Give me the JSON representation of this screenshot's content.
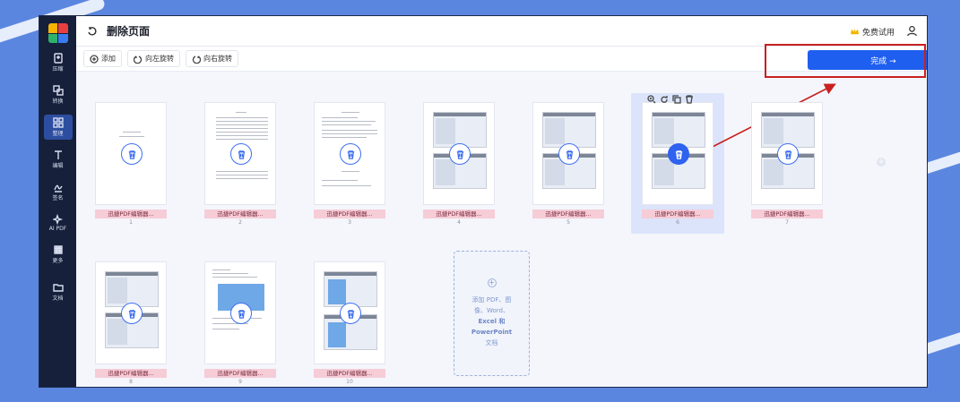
{
  "app": {
    "title": "删除页面",
    "trial_label": "免费试用"
  },
  "sidebar": {
    "items": [
      {
        "label": "压缩",
        "icon": "compress-icon"
      },
      {
        "label": "转换",
        "icon": "convert-icon"
      },
      {
        "label": "整理",
        "icon": "organize-icon",
        "active": true
      },
      {
        "label": "编辑",
        "icon": "text-edit-icon"
      },
      {
        "label": "签名",
        "icon": "signature-icon"
      },
      {
        "label": "AI PDF",
        "icon": "ai-sparkle-icon"
      },
      {
        "label": "更多",
        "icon": "grid-more-icon"
      },
      {
        "label": "文档",
        "icon": "folder-icon"
      }
    ]
  },
  "toolbar": {
    "add_label": "添加",
    "rotate_left_label": "向左旋转",
    "rotate_right_label": "向右旋转"
  },
  "done_button": {
    "label": "完成 →"
  },
  "pages": [
    {
      "label": "迅捷PDF编辑器...",
      "number": "1"
    },
    {
      "label": "迅捷PDF编辑器...",
      "number": "2"
    },
    {
      "label": "迅捷PDF编辑器...",
      "number": "3"
    },
    {
      "label": "迅捷PDF编辑器...",
      "number": "4"
    },
    {
      "label": "迅捷PDF编辑器...",
      "number": "5"
    },
    {
      "label": "迅捷PDF编辑器...",
      "number": "6",
      "selected": true
    },
    {
      "label": "迅捷PDF编辑器...",
      "number": "7"
    },
    {
      "label": "迅捷PDF编辑器...",
      "number": "8"
    },
    {
      "label": "迅捷PDF编辑器...",
      "number": "9"
    },
    {
      "label": "迅捷PDF编辑器...",
      "number": "10"
    }
  ],
  "add_card": {
    "line1": "添加 PDF、图",
    "line2": "像、Word、",
    "line3": "Excel 和",
    "line4": "PowerPoint",
    "line5": "文档"
  },
  "colors": {
    "accent": "#1f5ff0",
    "annotation_red": "#c92020",
    "label_pink": "#f6ccd7",
    "sidebar_bg": "#16203a"
  }
}
